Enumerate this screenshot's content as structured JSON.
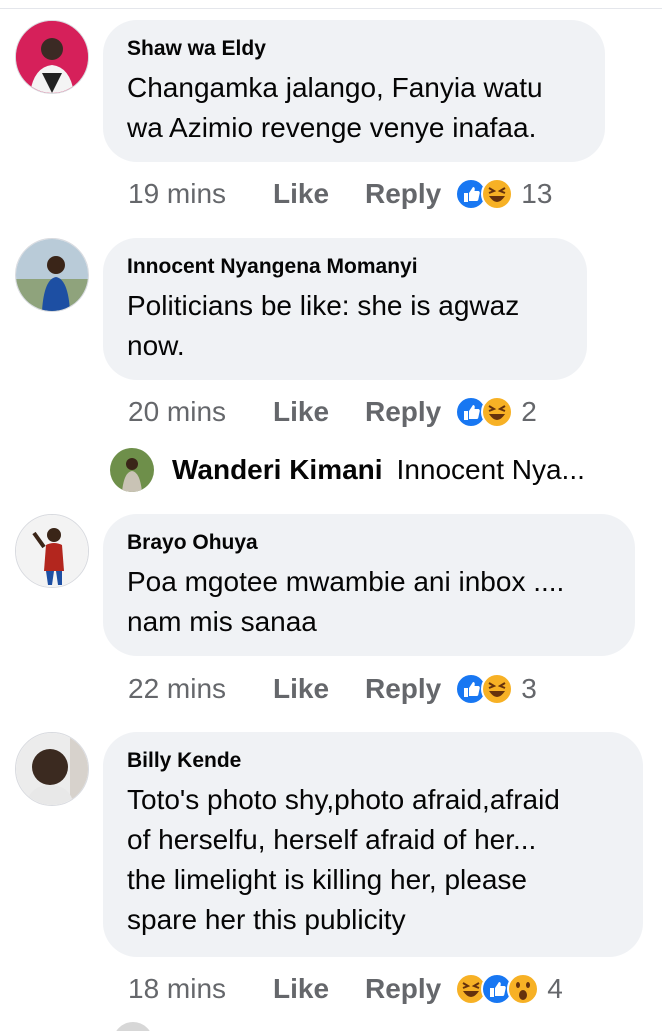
{
  "comments": [
    {
      "author": "Shaw wa Eldy",
      "lines": [
        "Changamka jalango, Fanyia watu",
        "wa Azimio revenge venye inafaa."
      ],
      "time": "19 mins",
      "like_label": "Like",
      "reply_label": "Reply",
      "reactions": [
        "like-reaction-icon",
        "haha-reaction-icon"
      ],
      "reaction_count": "13"
    },
    {
      "author": "Innocent Nyangena Momanyi",
      "lines": [
        "Politicians be like: she is agwaz",
        "now."
      ],
      "time": "20 mins",
      "like_label": "Like",
      "reply_label": "Reply",
      "reactions": [
        "like-reaction-icon",
        "haha-reaction-icon"
      ],
      "reaction_count": "2"
    },
    {
      "author": "Brayo Ohuya",
      "lines": [
        "Poa mgotee mwambie ani inbox ....",
        "nam mis sanaa"
      ],
      "time": "22 mins",
      "like_label": "Like",
      "reply_label": "Reply",
      "reactions": [
        "like-reaction-icon",
        "haha-reaction-icon"
      ],
      "reaction_count": "3"
    },
    {
      "author": "Billy Kende",
      "lines": [
        "Toto's photo shy,photo afraid,afraid",
        "of herselfu, herself afraid of her...",
        "the limelight is killing her, please",
        "spare her this publicity"
      ],
      "time": "18 mins",
      "like_label": "Like",
      "reply_label": "Reply",
      "reactions": [
        "haha-reaction-icon",
        "like-reaction-icon",
        "wow-reaction-icon"
      ],
      "reaction_count": "4"
    }
  ],
  "reply_preview": {
    "author": "Wanderi Kimani",
    "snippet": "Innocent Nya..."
  },
  "colors": {
    "bubble": "#f0f2f5",
    "meta_text": "#65676b",
    "like_blue": "#1877f2",
    "haha_yellow": "#f7b125"
  }
}
